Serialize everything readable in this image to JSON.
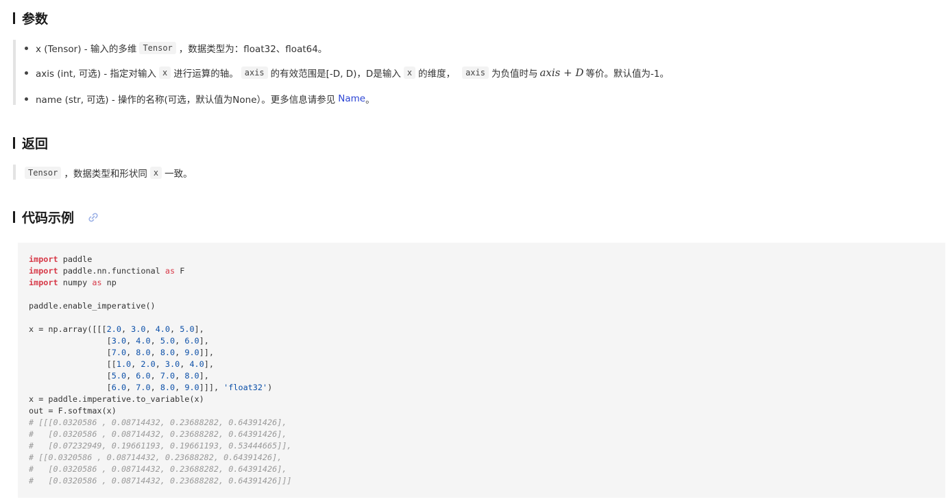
{
  "params": {
    "title": "参数",
    "items": [
      {
        "a": "x (Tensor) - 输入的多维",
        "code1": "Tensor",
        "b": "，数据类型为：float32、float64。"
      },
      {
        "a": "axis (int, 可选) - 指定对输入",
        "code1": "x",
        "b": "进行运算的轴。",
        "code2": "axis",
        "c": "的有效范围是[-D, D)，D是输入",
        "code3": "x",
        "d": "的维度，",
        "code4": "axis",
        "e": "为负值时与",
        "math": "axis + D",
        "f": "等价。默认值为-1。"
      },
      {
        "a": "name (str, 可选) - 操作的名称(可选，默认值为None）。更多信息请参见",
        "link": "Name",
        "b": "。"
      }
    ]
  },
  "returns": {
    "title": "返回",
    "code1": "Tensor",
    "a": "，数据类型和形状同",
    "code2": "x",
    "b": "一致。"
  },
  "example": {
    "title": "代码示例",
    "link_icon": "link-icon"
  },
  "colors": {
    "keyword": "#d73a49",
    "number": "#0b4fa8",
    "comment": "#999999",
    "link": "#2b44d4"
  },
  "code_lines": [
    [
      [
        "kw",
        "import"
      ],
      [
        "t",
        " paddle"
      ]
    ],
    [
      [
        "kw",
        "import"
      ],
      [
        "t",
        " paddle.nn.functional "
      ],
      [
        "kwas",
        "as"
      ],
      [
        "t",
        " F"
      ]
    ],
    [
      [
        "kw",
        "import"
      ],
      [
        "t",
        " numpy "
      ],
      [
        "kwas",
        "as"
      ],
      [
        "t",
        " np"
      ]
    ],
    [],
    [
      [
        "t",
        "paddle.enable_imperative()"
      ]
    ],
    [],
    [
      [
        "t",
        "x = np.array([[["
      ],
      [
        "num",
        "2.0"
      ],
      [
        "t",
        ", "
      ],
      [
        "num",
        "3.0"
      ],
      [
        "t",
        ", "
      ],
      [
        "num",
        "4.0"
      ],
      [
        "t",
        ", "
      ],
      [
        "num",
        "5.0"
      ],
      [
        "t",
        "],"
      ]
    ],
    [
      [
        "t",
        "                ["
      ],
      [
        "num",
        "3.0"
      ],
      [
        "t",
        ", "
      ],
      [
        "num",
        "4.0"
      ],
      [
        "t",
        ", "
      ],
      [
        "num",
        "5.0"
      ],
      [
        "t",
        ", "
      ],
      [
        "num",
        "6.0"
      ],
      [
        "t",
        "],"
      ]
    ],
    [
      [
        "t",
        "                ["
      ],
      [
        "num",
        "7.0"
      ],
      [
        "t",
        ", "
      ],
      [
        "num",
        "8.0"
      ],
      [
        "t",
        ", "
      ],
      [
        "num",
        "8.0"
      ],
      [
        "t",
        ", "
      ],
      [
        "num",
        "9.0"
      ],
      [
        "t",
        "]],"
      ]
    ],
    [
      [
        "t",
        "                [["
      ],
      [
        "num",
        "1.0"
      ],
      [
        "t",
        ", "
      ],
      [
        "num",
        "2.0"
      ],
      [
        "t",
        ", "
      ],
      [
        "num",
        "3.0"
      ],
      [
        "t",
        ", "
      ],
      [
        "num",
        "4.0"
      ],
      [
        "t",
        "],"
      ]
    ],
    [
      [
        "t",
        "                ["
      ],
      [
        "num",
        "5.0"
      ],
      [
        "t",
        ", "
      ],
      [
        "num",
        "6.0"
      ],
      [
        "t",
        ", "
      ],
      [
        "num",
        "7.0"
      ],
      [
        "t",
        ", "
      ],
      [
        "num",
        "8.0"
      ],
      [
        "t",
        "],"
      ]
    ],
    [
      [
        "t",
        "                ["
      ],
      [
        "num",
        "6.0"
      ],
      [
        "t",
        ", "
      ],
      [
        "num",
        "7.0"
      ],
      [
        "t",
        ", "
      ],
      [
        "num",
        "8.0"
      ],
      [
        "t",
        ", "
      ],
      [
        "num",
        "9.0"
      ],
      [
        "t",
        "]]], "
      ],
      [
        "str",
        "'float32'"
      ],
      [
        "t",
        ")"
      ]
    ],
    [
      [
        "t",
        "x = paddle.imperative.to_variable(x)"
      ]
    ],
    [
      [
        "t",
        "out = F.softmax(x)"
      ]
    ],
    [
      [
        "cm",
        "# [[[0.0320586 , 0.08714432, 0.23688282, 0.64391426],"
      ]
    ],
    [
      [
        "cm",
        "#   [0.0320586 , 0.08714432, 0.23688282, 0.64391426],"
      ]
    ],
    [
      [
        "cm",
        "#   [0.07232949, 0.19661193, 0.19661193, 0.53444665]],"
      ]
    ],
    [
      [
        "cm",
        "# [[0.0320586 , 0.08714432, 0.23688282, 0.64391426],"
      ]
    ],
    [
      [
        "cm",
        "#   [0.0320586 , 0.08714432, 0.23688282, 0.64391426],"
      ]
    ],
    [
      [
        "cm",
        "#   [0.0320586 , 0.08714432, 0.23688282, 0.64391426]]]"
      ]
    ]
  ]
}
